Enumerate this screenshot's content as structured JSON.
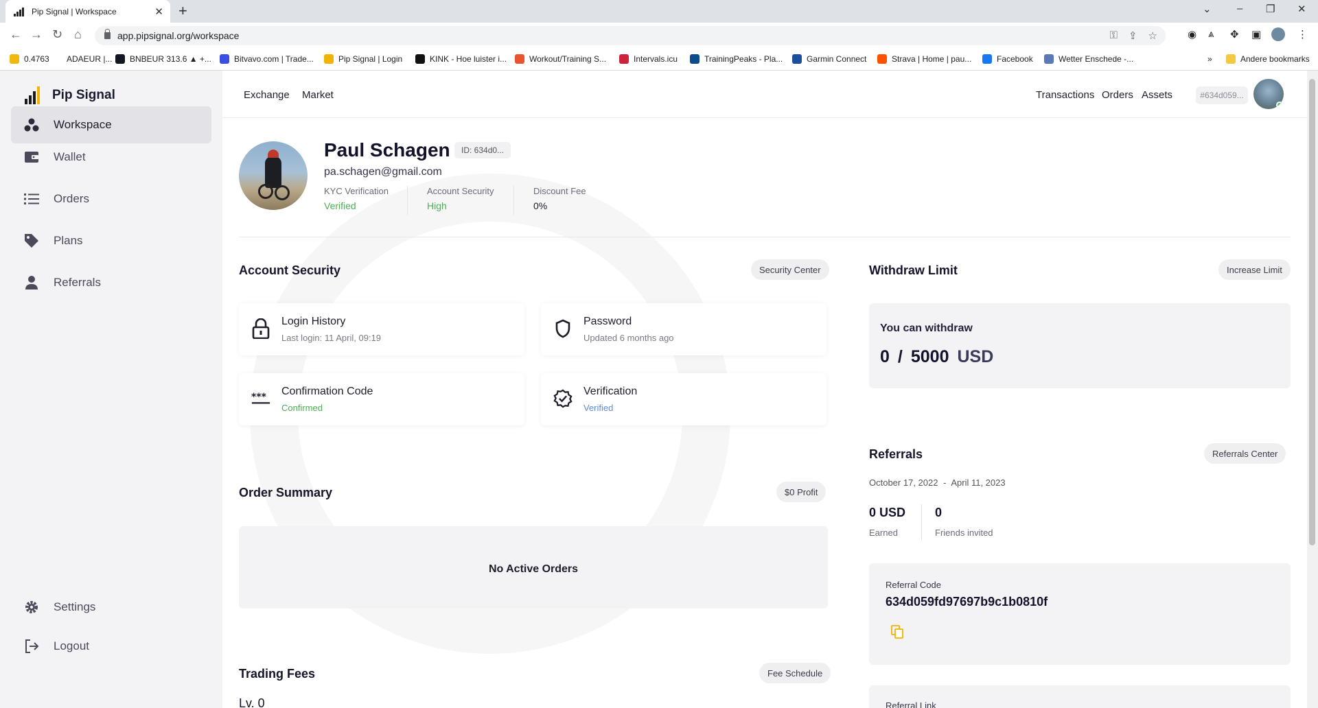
{
  "browser": {
    "tab_title": "Pip Signal | Workspace",
    "url": "app.pipsignal.org/workspace",
    "bookmarks": [
      {
        "label": "0.4763",
        "color": "#f0b90b"
      },
      {
        "label": "ADAEUR |...",
        "color": "#ffffff"
      },
      {
        "label": "BNBEUR 313.6 ▲ +...",
        "color": "#131722"
      },
      {
        "label": "Bitvavo.com | Trade...",
        "color": "#3b50e0"
      },
      {
        "label": "Pip Signal | Login",
        "color": "#f2b200"
      },
      {
        "label": "KINK - Hoe luister i...",
        "color": "#111111"
      },
      {
        "label": "Workout/Training S...",
        "color": "#e8542e"
      },
      {
        "label": "Intervals.icu",
        "color": "#d0213b"
      },
      {
        "label": "TrainingPeaks - Pla...",
        "color": "#0b4c8c"
      },
      {
        "label": "Garmin Connect",
        "color": "#1b4f9c"
      },
      {
        "label": "Strava | Home | pau...",
        "color": "#fc5200"
      },
      {
        "label": "Facebook",
        "color": "#1877f2"
      },
      {
        "label": "Wetter Enschede -...",
        "color": "#5a79b8"
      }
    ],
    "other_bookmarks": "Andere bookmarks"
  },
  "sidebar": {
    "brand": "Pip Signal",
    "brand_sub": "Pip",
    "items": [
      {
        "label": "Workspace",
        "icon": "workspace-icon"
      },
      {
        "label": "Wallet",
        "icon": "wallet-icon"
      },
      {
        "label": "Orders",
        "icon": "list-icon"
      },
      {
        "label": "Plans",
        "icon": "tag-icon"
      },
      {
        "label": "Referrals",
        "icon": "user-icon"
      }
    ],
    "settings": "Settings",
    "logout": "Logout"
  },
  "topnav": {
    "left": [
      "Exchange",
      "Market"
    ],
    "right": [
      "Transactions",
      "Orders",
      "Assets"
    ],
    "user_id": "#634d059..."
  },
  "profile": {
    "name": "Paul Schagen",
    "id": "ID: 634d0...",
    "email": "pa.schagen@gmail.com",
    "stats": [
      {
        "label": "KYC Verification",
        "value": "Verified"
      },
      {
        "label": "Account Security",
        "value": "High"
      },
      {
        "label": "Discount Fee",
        "value": "0%"
      }
    ]
  },
  "account_security": {
    "title": "Account Security",
    "button": "Security Center",
    "cards": [
      {
        "title": "Login History",
        "sub": "Last login: 11 April, 09:19"
      },
      {
        "title": "Password",
        "sub": "Updated 6 months ago"
      },
      {
        "title": "Confirmation Code",
        "sub": "Confirmed"
      },
      {
        "title": "Verification",
        "sub": "Verified"
      }
    ]
  },
  "order_summary": {
    "title": "Order Summary",
    "button": "$0 Profit",
    "empty": "No Active Orders"
  },
  "trading_fees": {
    "title": "Trading Fees",
    "button": "Fee Schedule",
    "level": "Lv. 0"
  },
  "withdraw": {
    "title": "Withdraw Limit",
    "button": "Increase Limit",
    "label": "You can withdraw",
    "amount": "0",
    "separator": "/",
    "limit": "5000",
    "currency": "USD"
  },
  "referrals": {
    "title": "Referrals",
    "button": "Referrals Center",
    "date_from": "October 17, 2022",
    "date_sep": "-",
    "date_to": "April 11, 2023",
    "earned_value": "0 USD",
    "earned_label": "Earned",
    "invited_value": "0",
    "invited_label": "Friends invited",
    "code_label": "Referral Code",
    "code": "634d059fd97697b9c1b0810f",
    "link_label": "Referral Link"
  },
  "colors": {
    "accent_green": "#4caf50",
    "accent_blue": "#5b8bd6",
    "brand_yellow": "#f2b200",
    "copy_icon": "#f2b200"
  }
}
